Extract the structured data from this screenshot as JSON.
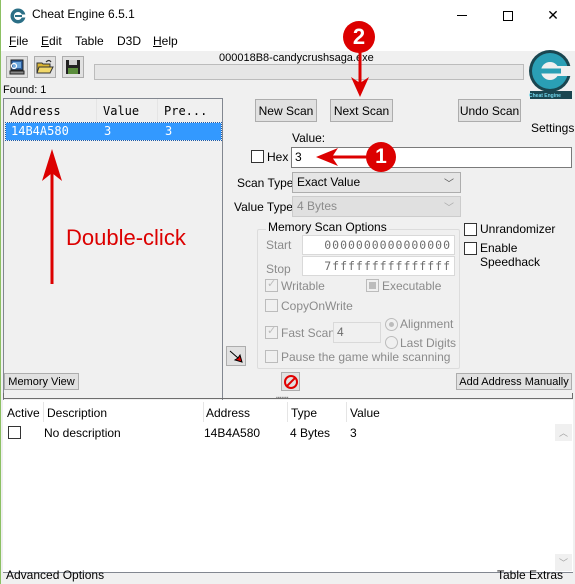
{
  "window": {
    "title": "Cheat Engine 6.5.1",
    "controls": {
      "minimize": "—",
      "maximize": "☐",
      "close": "✕"
    }
  },
  "menu": {
    "items": [
      {
        "label": "File",
        "accel": "F",
        "rest": "ile"
      },
      {
        "label": "Edit",
        "accel": "E",
        "rest": "dit"
      },
      {
        "label": "Table",
        "accel": "",
        "rest": "Table"
      },
      {
        "label": "D3D",
        "accel": "",
        "rest": "D3D"
      },
      {
        "label": "Help",
        "accel": "H",
        "rest": "elp"
      }
    ]
  },
  "toolbar": {
    "process_name": "000018B8-candycrushsaga.exe",
    "buttons": [
      "open-process",
      "open-file",
      "save-file"
    ],
    "progress": 0
  },
  "results": {
    "found_label": "Found: 1",
    "columns": [
      "Address",
      "Value",
      "Pre..."
    ],
    "rows": [
      {
        "address": "14B4A580",
        "value": "3",
        "previous": "3",
        "selected": true
      }
    ]
  },
  "scan": {
    "new_scan": "New Scan",
    "next_scan": "Next Scan",
    "undo_scan": "Undo Scan",
    "settings": "Settings",
    "logo_caption": "Cheat Engine",
    "value_label": "Value:",
    "hex_label": "Hex",
    "hex_checked": false,
    "value": "3",
    "scan_type_label": "Scan Type",
    "scan_type": "Exact Value",
    "value_type_label": "Value Type",
    "value_type": "4 Bytes"
  },
  "memory_options": {
    "title": "Memory Scan Options",
    "start_label": "Start",
    "start": "0000000000000000",
    "stop_label": "Stop",
    "stop": "7fffffffffffffff",
    "writable": "Writable",
    "writable_checked": true,
    "executable": "Executable",
    "executable_state": "indeterminate",
    "copy_on_write": "CopyOnWrite",
    "copy_on_write_checked": false,
    "fast_scan": "Fast Scan",
    "fast_scan_checked": true,
    "fast_scan_value": "4",
    "alignment": "Alignment",
    "alignment_selected": true,
    "last_digits": "Last Digits",
    "pause": "Pause the game while scanning",
    "pause_checked": false
  },
  "extras": {
    "unrandomizer": "Unrandomizer",
    "speedhack": "Enable Speedhack"
  },
  "bottom_buttons": {
    "memory_view": "Memory View",
    "add_address": "Add Address Manually"
  },
  "address_list": {
    "columns": [
      "Active",
      "Description",
      "Address",
      "Type",
      "Value"
    ],
    "rows": [
      {
        "active": false,
        "description": "No description",
        "address": "14B4A580",
        "type": "4 Bytes",
        "value": "3"
      }
    ]
  },
  "statusbar": {
    "left": "Advanced Options",
    "right": "Table Extras"
  },
  "annotations": {
    "step1": "1",
    "step2": "2",
    "double_click": "Double-click",
    "color": "#dc0000"
  }
}
